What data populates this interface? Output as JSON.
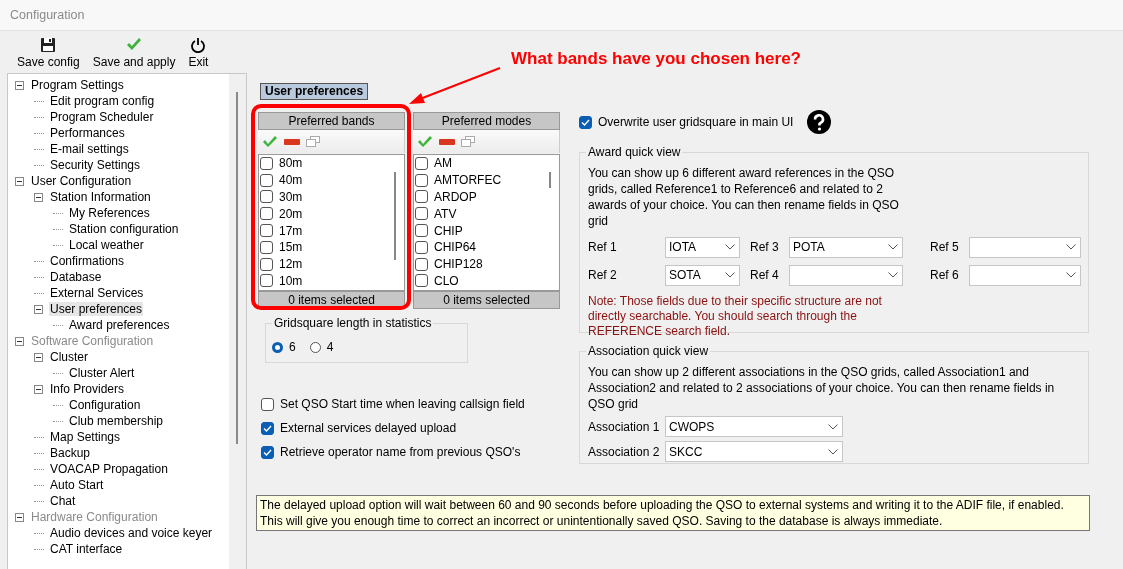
{
  "window": {
    "title": "Configuration"
  },
  "toolbar": [
    {
      "kind": "save",
      "label": "Save config"
    },
    {
      "kind": "apply",
      "label": "Save and apply"
    },
    {
      "kind": "exit",
      "label": "Exit"
    }
  ],
  "tree": [
    {
      "label": "Program Settings",
      "disabled": false,
      "selected": false,
      "expanded": true,
      "children": [
        {
          "label": "Edit program config",
          "selected": false
        },
        {
          "label": "Program Scheduler",
          "selected": false
        },
        {
          "label": "Performances",
          "selected": false
        },
        {
          "label": "E-mail settings",
          "selected": false
        },
        {
          "label": "Security Settings",
          "selected": false
        }
      ]
    },
    {
      "label": "User Configuration",
      "disabled": false,
      "selected": false,
      "expanded": true,
      "children": [
        {
          "label": "Station Information",
          "selected": false,
          "expanded": true,
          "children": [
            {
              "label": "My References",
              "selected": false
            },
            {
              "label": "Station configuration",
              "selected": false
            },
            {
              "label": "Local weather",
              "selected": false
            }
          ]
        },
        {
          "label": "Confirmations",
          "selected": false
        },
        {
          "label": "Database",
          "selected": false
        },
        {
          "label": "External Services",
          "selected": false
        },
        {
          "label": "User preferences",
          "selected": true,
          "expanded": true,
          "children": [
            {
              "label": "Award preferences",
              "selected": false
            }
          ]
        }
      ]
    },
    {
      "label": "Software Configuration",
      "disabled": true,
      "selected": false,
      "expanded": true,
      "children": [
        {
          "label": "Cluster",
          "selected": false,
          "expanded": true,
          "children": [
            {
              "label": "Cluster Alert",
              "selected": false
            }
          ]
        },
        {
          "label": "Info Providers",
          "selected": false,
          "expanded": true,
          "children": [
            {
              "label": "Configuration",
              "selected": false
            },
            {
              "label": "Club membership",
              "selected": false
            }
          ]
        },
        {
          "label": "Map Settings",
          "selected": false
        },
        {
          "label": "Backup",
          "selected": false
        },
        {
          "label": "VOACAP Propagation",
          "selected": false
        },
        {
          "label": "Auto Start",
          "selected": false
        },
        {
          "label": "Chat",
          "selected": false
        }
      ]
    },
    {
      "label": "Hardware Configuration",
      "disabled": true,
      "selected": false,
      "expanded": true,
      "children": [
        {
          "label": "Audio devices and voice keyer",
          "selected": false
        },
        {
          "label": "CAT interface",
          "selected": false
        }
      ]
    }
  ],
  "section_title": "User preferences",
  "lists": [
    {
      "title": "Preferred bands",
      "footer": "0 items selected",
      "items": [
        {
          "label": "80m",
          "checked": false
        },
        {
          "label": "40m",
          "checked": false
        },
        {
          "label": "30m",
          "checked": false
        },
        {
          "label": "20m",
          "checked": false
        },
        {
          "label": "17m",
          "checked": false
        },
        {
          "label": "15m",
          "checked": false
        },
        {
          "label": "12m",
          "checked": false
        },
        {
          "label": "10m",
          "checked": false
        }
      ]
    },
    {
      "title": "Preferred modes",
      "footer": "0 items selected",
      "items": [
        {
          "label": "AM",
          "checked": false
        },
        {
          "label": "AMTORFEC",
          "checked": false
        },
        {
          "label": "ARDOP",
          "checked": false
        },
        {
          "label": "ATV",
          "checked": false
        },
        {
          "label": "CHIP",
          "checked": false
        },
        {
          "label": "CHIP64",
          "checked": false
        },
        {
          "label": "CHIP128",
          "checked": false
        },
        {
          "label": "CLO",
          "checked": false
        }
      ]
    }
  ],
  "gridsquare": {
    "title": "Gridsquare length in statistics",
    "options": [
      {
        "label": "6",
        "selected": true
      },
      {
        "label": "4",
        "selected": false
      }
    ]
  },
  "options": [
    {
      "label": "Set QSO Start time when leaving callsign field",
      "checked": false
    },
    {
      "label": "External services delayed upload",
      "checked": true
    },
    {
      "label": "Retrieve operator name from previous QSO's",
      "checked": true
    }
  ],
  "overwrite": {
    "label": "Overwrite user gridsquare in main UI",
    "checked": true
  },
  "award": {
    "title": "Award quick view",
    "description": "You can show up 6 different award references in the QSO grids, called Reference1 to Reference6 and related to 2 awards of your choice. You can then rename fields in QSO grid",
    "refs": [
      {
        "label": "Ref 1",
        "value": "IOTA"
      },
      {
        "label": "Ref 2",
        "value": "SOTA"
      },
      {
        "label": "Ref 3",
        "value": "POTA"
      },
      {
        "label": "Ref 4"
      },
      {
        "label": "Ref 5"
      },
      {
        "label": "Ref 6"
      }
    ],
    "note": "Note: Those fields due to their specific structure are not directly searchable. You should search through the REFERENCE search field."
  },
  "association": {
    "title": "Association quick view",
    "description": "You can show up 2 different associations in the QSO grids, called Association1 and Association2 and related to 2 associations of your choice. You can then rename fields in QSO grid",
    "items": [
      {
        "label": "Association 1",
        "value": "CWOPS"
      },
      {
        "label": "Association 2",
        "value": "SKCC"
      }
    ]
  },
  "info": "The delayed upload option will wait between 60 and 90 seconds before uploading the QSO to external systems and writing it to the ADIF file, if enabled. This will give you enough time to correct an incorrect or unintentionally saved QSO. Saving to the database is always immediate.",
  "annotation": {
    "text": "What bands have you chosen here?"
  }
}
